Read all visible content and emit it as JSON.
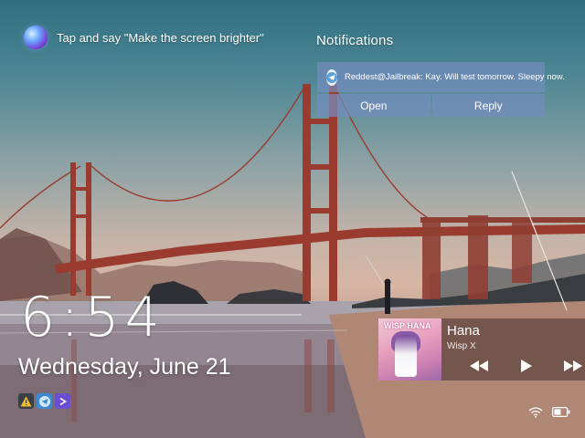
{
  "siri": {
    "prompt": "Tap and say \"Make the screen brighter\""
  },
  "notifications": {
    "title": "Notifications",
    "items": [
      {
        "app_icon": "telegram-icon",
        "text": "Reddest@Jailbreak: Kay. Will test tomorrow. Sleepy now."
      }
    ],
    "actions": {
      "open": "Open",
      "reply": "Reply"
    }
  },
  "clock": {
    "time": "6:54",
    "date": "Wednesday, June 21"
  },
  "status_icons": [
    "warning-icon",
    "telegram-icon",
    "terminal-icon"
  ],
  "now_playing": {
    "title": "Hana",
    "artist": "Wisp X",
    "album_art_text": "WISP HANA",
    "controls": [
      "rewind-icon",
      "play-icon",
      "fast-forward-icon"
    ]
  },
  "system_status": [
    "wifi-icon",
    "battery-icon"
  ]
}
